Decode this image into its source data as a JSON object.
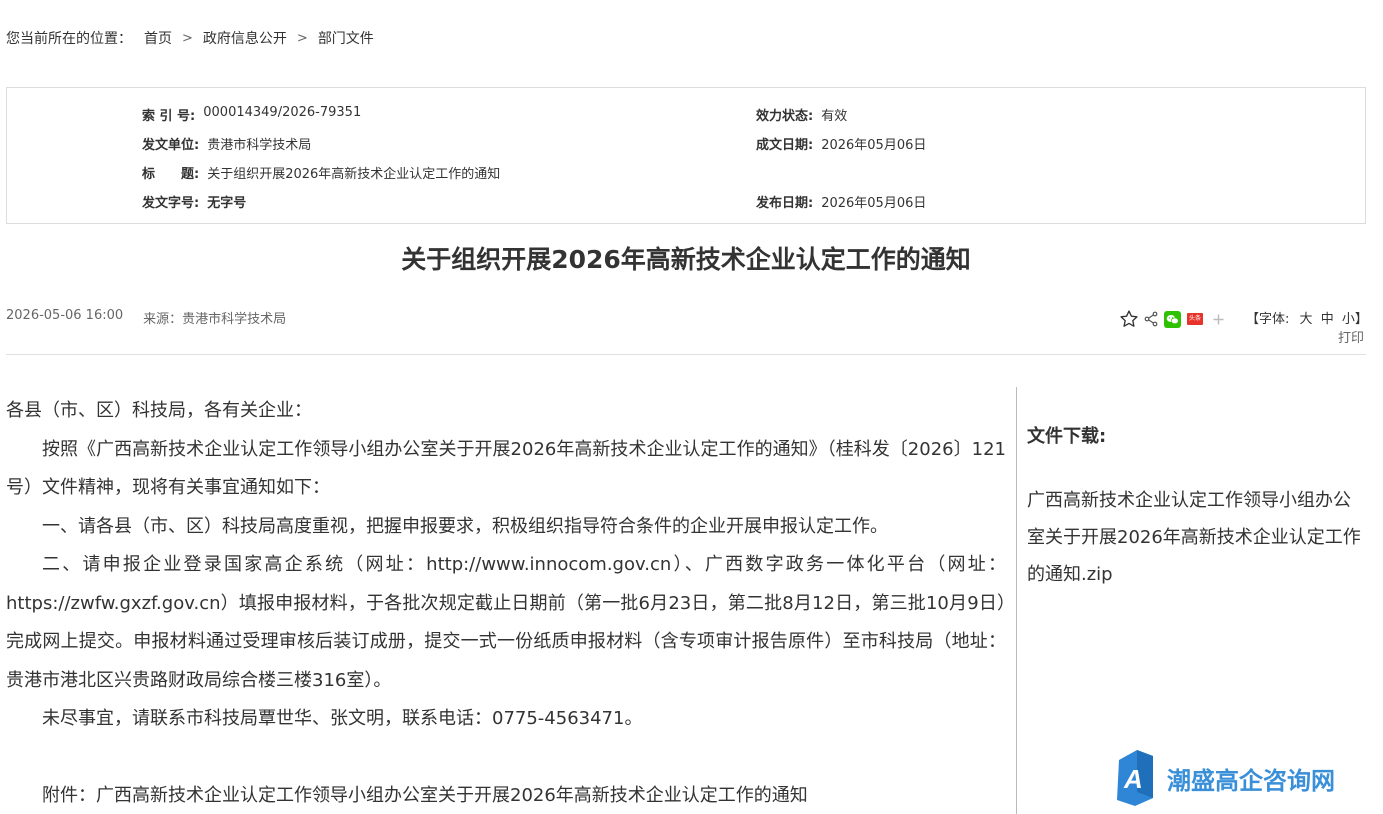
{
  "breadcrumb": {
    "prefix": "您当前所在的位置：",
    "items": [
      "首页",
      "政府信息公开",
      "部门文件"
    ],
    "separator": ">"
  },
  "meta": {
    "index_label": "索 引 号:",
    "index_value": "000014349/2026-79351",
    "status_label": "效力状态:",
    "status_value": "有效",
    "issuer_label": "发文单位:",
    "issuer_value": "贵港市科学技术局",
    "created_label": "成文日期:",
    "created_value": "2026年05月06日",
    "title_label": "标　　题:",
    "title_value": "关于组织开展2026年高新技术企业认定工作的通知",
    "docno_label": "发文字号:",
    "docno_value": "无字号",
    "published_label": "发布日期:",
    "published_value": "2026年05月06日"
  },
  "article": {
    "title": "关于组织开展2026年高新技术企业认定工作的通知",
    "datetime": "2026-05-06 16:00",
    "source": "来源：贵港市科学技术局",
    "paragraphs": [
      "各县（市、区）科技局，各有关企业：",
      "按照《广西高新技术企业认定工作领导小组办公室关于开展2026年高新技术企业认定工作的通知》（桂科发〔2026〕121号）文件精神，现将有关事宜通知如下：",
      "一、请各县（市、区）科技局高度重视，把握申报要求，积极组织指导符合条件的企业开展申报认定工作。",
      "二、请申报企业登录国家高企系统（网址：http://www.innocom.gov.cn）、广西数字政务一体化平台（网址：https://zwfw.gxzf.gov.cn）填报申报材料，于各批次规定截止日期前（第一批6月23日，第二批8月12日，第三批10月9日）完成网上提交。申报材料通过受理审核后装订成册，提交一式一份纸质申报材料（含专项审计报告原件）至市科技局（地址：贵港市港北区兴贵路财政局综合楼三楼316室）。",
      "未尽事宜，请联系市科技局覃世华、张文明，联系电话：0775-4563471。",
      "附件：广西高新技术企业认定工作领导小组办公室关于开展2026年高新技术企业认定工作的通知"
    ]
  },
  "toolbar": {
    "font_prefix": "【字体:",
    "font_large": "大",
    "font_medium": "中",
    "font_small": "小】",
    "print": "打印",
    "toutiao_label": "头条",
    "icons": [
      "star-icon",
      "share-icon",
      "wechat-icon",
      "toutiao-icon",
      "plus-icon"
    ]
  },
  "sidebar": {
    "download_title": "文件下载:",
    "download_file": "广西高新技术企业认定工作领导小组办公室关于开展2026年高新技术企业认定工作的通知.zip"
  },
  "watermark": {
    "text": "潮盛高企咨询网",
    "logo_letter": "A"
  },
  "colors": {
    "text": "#333333",
    "muted": "#666666",
    "border": "#dcdcdc",
    "wechat_green": "#2dc100",
    "toutiao_red": "#e8332a",
    "watermark_blue": "#3a8fd9"
  }
}
